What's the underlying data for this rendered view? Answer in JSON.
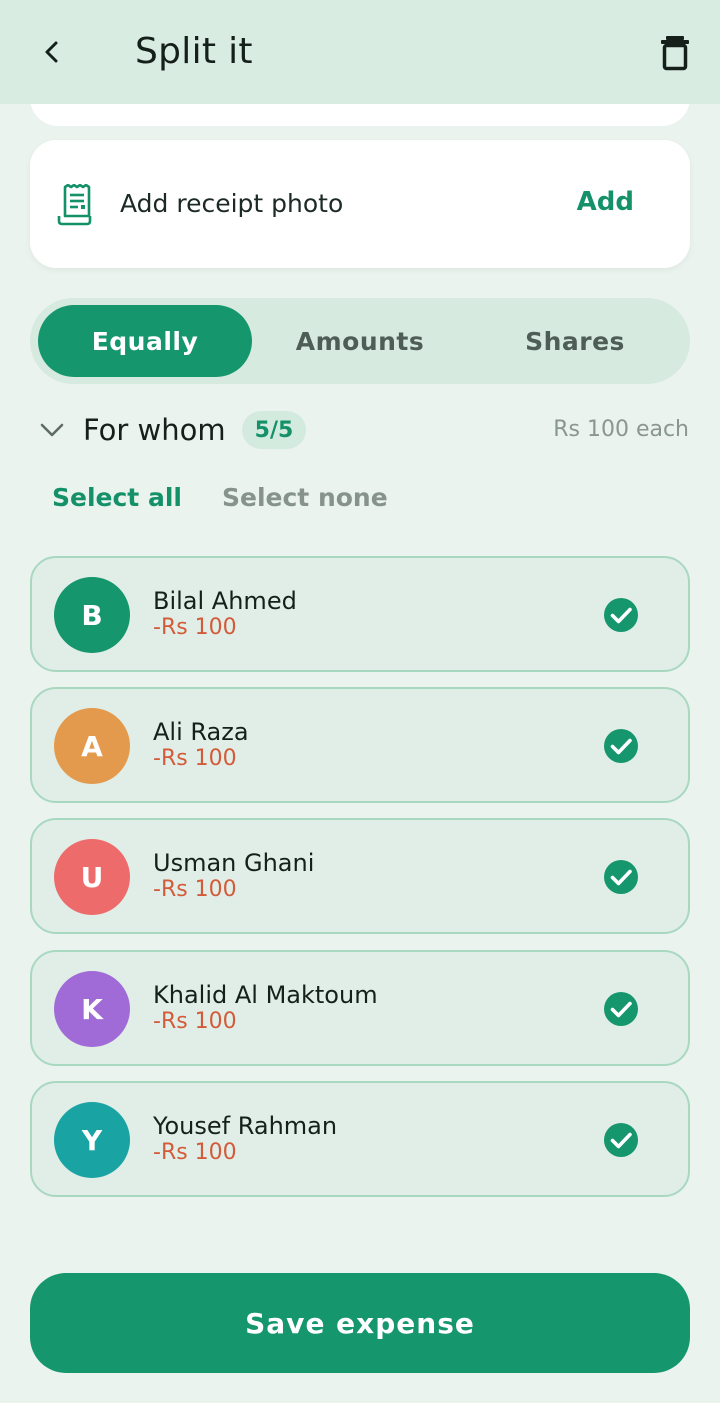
{
  "appbar": {
    "title": "Split it",
    "back_icon": "chevron-left-icon",
    "delete_icon": "trash-icon"
  },
  "receipt": {
    "label": "Add receipt photo",
    "action": "Add",
    "icon": "receipt-icon"
  },
  "split_modes": {
    "selected": "Equally",
    "options": [
      "Equally",
      "Amounts",
      "Shares"
    ]
  },
  "for_whom": {
    "title": "For whom",
    "count": "5/5",
    "each": "Rs 100 each",
    "select_all": "Select all",
    "select_none": "Select none"
  },
  "members": [
    {
      "initial": "B",
      "name": "Bilal Ahmed",
      "amount": "-Rs 100",
      "color": "#15966d",
      "checked": true
    },
    {
      "initial": "A",
      "name": "Ali Raza",
      "amount": "-Rs 100",
      "color": "#e49a4c",
      "checked": true
    },
    {
      "initial": "U",
      "name": "Usman Ghani",
      "amount": "-Rs 100",
      "color": "#ee6b6b",
      "checked": true
    },
    {
      "initial": "K",
      "name": "Khalid Al Maktoum",
      "amount": "-Rs 100",
      "color": "#a06bd6",
      "checked": true
    },
    {
      "initial": "Y",
      "name": "Yousef Rahman",
      "amount": "-Rs 100",
      "color": "#19a3a3",
      "checked": true
    }
  ],
  "footer": {
    "save_label": "Save expense"
  },
  "colors": {
    "accent": "#15966d",
    "negative_amount": "#d45b39",
    "background": "#eaf3ee"
  }
}
